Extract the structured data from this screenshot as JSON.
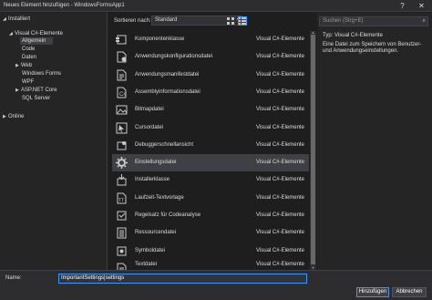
{
  "window": {
    "title": "Neues Element hinzufügen - WindowsFormsApp1",
    "help_glyph": "?",
    "close_glyph": "✕"
  },
  "tree": {
    "installiert": "Installiert",
    "visual_cs": "Visual C#-Elemente",
    "allgemein": "Allgemein",
    "code": "Code",
    "daten": "Daten",
    "web": "Web",
    "windows_forms": "Windows Forms",
    "wpf": "WPF",
    "aspnet_core": "ASP.NET Core",
    "sql_server": "SQL Server",
    "online": "Online",
    "expanded_glyph": "◢",
    "collapsed_glyph": "▶"
  },
  "toolbar": {
    "sort_label": "Sortieren nach:",
    "sort_value": "Standard",
    "chevron": "▾"
  },
  "search": {
    "placeholder": "Suchen (Strg+E)",
    "icon_glyph": "⌕"
  },
  "items": [
    {
      "name": "Komponentenklasse",
      "category": "Visual C#-Elemente",
      "icon": "component-class-icon"
    },
    {
      "name": "Anwendungskonfigurationsdatei",
      "category": "Visual C#-Elemente",
      "icon": "app-config-icon"
    },
    {
      "name": "Anwendungsmanifestdatei",
      "category": "Visual C#-Elemente",
      "icon": "app-manifest-icon"
    },
    {
      "name": "Assemblyinformationsdatei",
      "category": "Visual C#-Elemente",
      "icon": "assembly-info-icon"
    },
    {
      "name": "Bitmapdatei",
      "category": "Visual C#-Elemente",
      "icon": "bitmap-icon"
    },
    {
      "name": "Cursordatei",
      "category": "Visual C#-Elemente",
      "icon": "cursor-icon"
    },
    {
      "name": "Debuggerschnellansicht",
      "category": "Visual C#-Elemente",
      "icon": "debugger-visualizer-icon"
    },
    {
      "name": "Einstellungsdatei",
      "category": "Visual C#-Elemente",
      "icon": "settings-gear-icon"
    },
    {
      "name": "Installerklasse",
      "category": "Visual C#-Elemente",
      "icon": "installer-class-icon"
    },
    {
      "name": "Laufzeit-Textvorlage",
      "category": "Visual C#-Elemente",
      "icon": "runtime-template-icon"
    },
    {
      "name": "Regelsatz für Codeanalyse",
      "category": "Visual C#-Elemente",
      "icon": "ruleset-icon"
    },
    {
      "name": "Ressourcendatei",
      "category": "Visual C#-Elemente",
      "icon": "resource-file-icon"
    },
    {
      "name": "Symboldatei",
      "category": "Visual C#-Elemente",
      "icon": "icon-file-icon"
    },
    {
      "name": "Textdatei",
      "category": "Visual C#-Elemente",
      "icon": "text-file-icon"
    }
  ],
  "details": {
    "type_line": "Typ:  Visual C#-Elemente",
    "description": "Eine Datei zum Speichern von Benutzer- und Anwendungseinstellungen."
  },
  "form": {
    "name_label": "Name:",
    "name_value": "ImportantSettings|settings",
    "add_button": "Hinzufügen",
    "cancel_button": "Abbrechen"
  }
}
